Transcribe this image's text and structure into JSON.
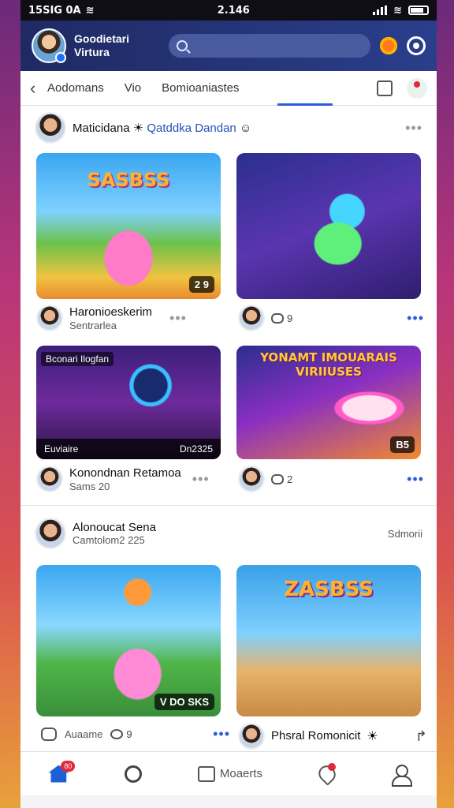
{
  "status_bar": {
    "left": "15SIG 0A",
    "time": "2.146"
  },
  "header": {
    "brand": "Goodietari Virtura",
    "search": {
      "placeholder": ""
    }
  },
  "tabs": {
    "items": [
      "Aodomans",
      "Vio",
      "Bomioaniastes"
    ],
    "active_index": 2
  },
  "post1": {
    "author": "Maticidana",
    "tag": "Qatddka Dandan",
    "cards": [
      {
        "title_art": "SASBSS",
        "badge": "2 9"
      },
      {
        "title_art": "",
        "badge": ""
      },
      {
        "topline": "Bconari Ilogfan",
        "caption_left": "Euviaire",
        "caption_right": "Dn2325"
      },
      {
        "title_art": "YONAMT IMOUARAIS VIRIIUSES",
        "badge": "B5"
      }
    ],
    "meta": [
      {
        "name": "Haronioeskerim",
        "sub": "Sentrarlea"
      },
      {
        "count": "9"
      },
      {
        "name": "Konondnan Retamoa",
        "sub": "Sams 20"
      },
      {
        "count": "2"
      }
    ]
  },
  "post2": {
    "author": "Alonoucat Sena",
    "sub": "Camtolom2 225",
    "right_label": "Sdmorii",
    "cards": [
      {
        "title_art": "",
        "badge": "V DO SKS"
      },
      {
        "title_art": "ZASBSS",
        "badge": ""
      }
    ],
    "footer": {
      "left_label": "Auaame",
      "count": "9",
      "name": "Phsral Romonicit"
    }
  },
  "bottom_nav": {
    "badge": "80",
    "moments_label": "Moaerts"
  },
  "colors": {
    "accent": "#2b5fd9",
    "header": "#1f2a63",
    "alert": "#e0283b"
  }
}
